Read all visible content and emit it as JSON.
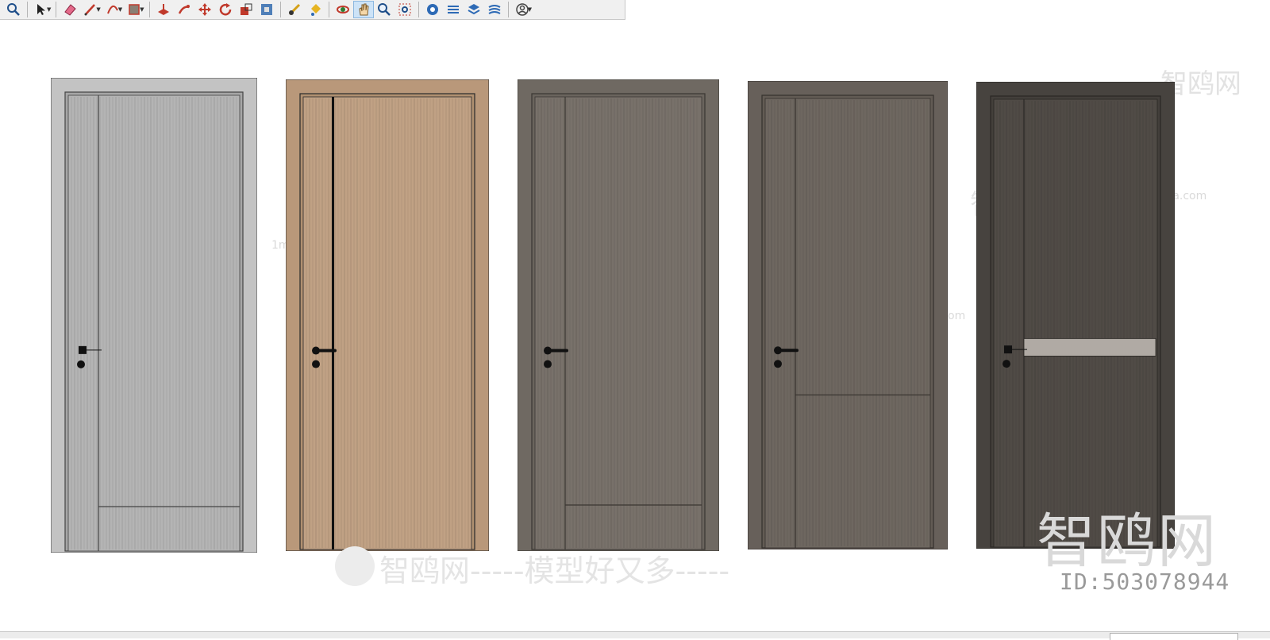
{
  "toolbar": {
    "tools": [
      {
        "icon": "zoom-extents-icon"
      },
      {
        "icon": "select-arrow-icon",
        "dropdown": true
      },
      {
        "icon": "eraser-icon"
      },
      {
        "icon": "pencil-line-icon",
        "dropdown": true
      },
      {
        "icon": "arc-icon",
        "dropdown": true
      },
      {
        "icon": "rectangle-shape-icon",
        "dropdown": true
      },
      {
        "icon": "push-pull-icon"
      },
      {
        "icon": "follow-me-icon"
      },
      {
        "icon": "move-icon"
      },
      {
        "icon": "rotate-icon"
      },
      {
        "icon": "scale-icon"
      },
      {
        "icon": "offset-icon"
      },
      {
        "icon": "tape-measure-icon"
      },
      {
        "icon": "paint-bucket-icon"
      },
      {
        "icon": "orbit-icon"
      },
      {
        "icon": "pan-hand-icon",
        "active": true
      },
      {
        "icon": "zoom-icon"
      },
      {
        "icon": "zoom-window-icon"
      },
      {
        "icon": "warehouse-icon"
      },
      {
        "icon": "extension-icon"
      },
      {
        "icon": "layers-icon"
      },
      {
        "icon": "sandbox-icon"
      },
      {
        "icon": "user-account-icon",
        "dropdown": true
      }
    ]
  },
  "doors": [
    {
      "name": "door-light-gray",
      "panel": "#b4b4b4",
      "frame": "#c3c3c3",
      "shade": "#a6a6a6",
      "lines": "#444444",
      "handle": "square",
      "accent": "bottom-rail"
    },
    {
      "name": "door-light-wood",
      "panel": "#c0a184",
      "frame": "#b9987a",
      "shade": "#b09070",
      "lines": "#2a2a2a",
      "handle": "lever",
      "accent": "black-stripe"
    },
    {
      "name": "door-warm-gray",
      "panel": "#78716a",
      "frame": "#6f6962",
      "shade": "#6a645d",
      "lines": "#3a3632",
      "handle": "lever",
      "accent": "bottom-rail"
    },
    {
      "name": "door-taupe",
      "panel": "#6e6760",
      "frame": "#67605a",
      "shade": "#625b54",
      "lines": "#35312d",
      "handle": "lever",
      "accent": "mid-rail"
    },
    {
      "name": "door-dark-charcoal",
      "panel": "#504b46",
      "frame": "#47433f",
      "shade": "#433f3b",
      "lines": "#2a2724",
      "handle": "square",
      "accent": "light-band"
    }
  ],
  "watermarks": {
    "brand": "智鸥网",
    "domain": "1miba.com",
    "slogan": "智鸥网-----模型好又多-----",
    "id_text": "ID:503078944"
  }
}
